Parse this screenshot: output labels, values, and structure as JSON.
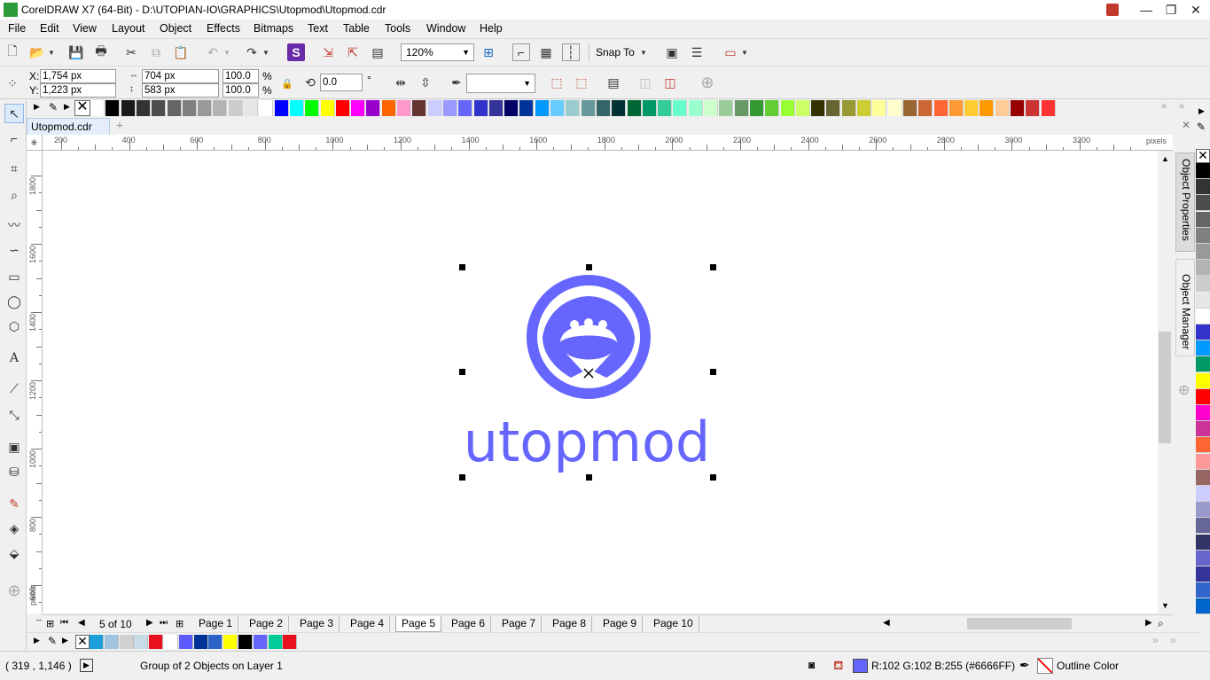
{
  "window": {
    "title": "CorelDRAW X7 (64-Bit) - D:\\UTOPIAN-IO\\GRAPHICS\\Utopmod\\Utopmod.cdr"
  },
  "menu": [
    "File",
    "Edit",
    "View",
    "Layout",
    "Object",
    "Effects",
    "Bitmaps",
    "Text",
    "Table",
    "Tools",
    "Window",
    "Help"
  ],
  "standard_toolbar": {
    "zoom": "120%",
    "snap_to": "Snap To"
  },
  "property_bar": {
    "x_label": "X:",
    "x_value": "1,754 px",
    "y_label": "Y:",
    "y_value": "1,223 px",
    "width_value": "704 px",
    "height_value": "583 px",
    "scale_w": "100.0",
    "scale_h": "100.0",
    "percent": "%",
    "rotation": "0.0",
    "degree": "°"
  },
  "document_tab": "Utopmod.cdr",
  "ruler": {
    "h_labels": [
      "200",
      "400",
      "600",
      "800",
      "1000",
      "1200",
      "1400",
      "1600",
      "1800",
      "2000",
      "2200",
      "2400",
      "2600",
      "2800",
      "3000",
      "3200"
    ],
    "h_units": "pixels",
    "v_labels": [
      "1800",
      "1600",
      "1400",
      "1200",
      "1000",
      "800",
      "600"
    ],
    "v_units": "pixels"
  },
  "logo": {
    "wordmark": "utopmod",
    "color": "#6666FF"
  },
  "dockers": [
    "Object Properties",
    "Object Manager"
  ],
  "pages": {
    "counter": "5 of 10",
    "tabs": [
      "Page 1",
      "Page 2",
      "Page 3",
      "Page 4",
      "Page 5",
      "Page 6",
      "Page 7",
      "Page 8",
      "Page 9",
      "Page 10"
    ],
    "active": "Page 5"
  },
  "status": {
    "coords": "( 319  , 1,146 )",
    "selection": "Group of 2 Objects on Layer 1",
    "fill_info": "R:102 G:102 B:255 (#6666FF)",
    "outline": "Outline Color"
  },
  "palette_top": [
    "#ffffff",
    "#000000",
    "#1a1a1a",
    "#333333",
    "#4d4d4d",
    "#666666",
    "#808080",
    "#999999",
    "#b3b3b3",
    "#cccccc",
    "#e6e6e6",
    "#ffffff",
    "#0000ff",
    "#00ffff",
    "#00ff00",
    "#ffff00",
    "#ff0000",
    "#ff00ff",
    "#9900cc",
    "#ff6600",
    "#ff99cc",
    "#663333",
    "#ccccff",
    "#9999ff",
    "#6666ff",
    "#3333cc",
    "#333399",
    "#000066",
    "#003399",
    "#0099ff",
    "#66ccff",
    "#99cccc",
    "#669999",
    "#336666",
    "#003333",
    "#006633",
    "#009966",
    "#33cc99",
    "#66ffcc",
    "#99ffcc",
    "#ccffcc",
    "#99cc99",
    "#669966",
    "#339933",
    "#66cc33",
    "#99ff33",
    "#ccff66",
    "#333300",
    "#666633",
    "#999933",
    "#cccc33",
    "#ffff99",
    "#ffffcc",
    "#996633",
    "#cc6633",
    "#ff6633",
    "#ff9933",
    "#ffcc33",
    "#ff9900",
    "#ffcc99",
    "#990000",
    "#cc3333",
    "#ff3333"
  ],
  "palette_right": [
    "#000000",
    "#333333",
    "#4d4d4d",
    "#666666",
    "#808080",
    "#999999",
    "#b3b3b3",
    "#cccccc",
    "#e6e6e6",
    "#ffffff",
    "#3333cc",
    "#0099ff",
    "#009966",
    "#ffff00",
    "#ff0000",
    "#ff00cc",
    "#cc3399",
    "#ff6633",
    "#ff9999",
    "#996666",
    "#ccccff",
    "#9999cc",
    "#666699",
    "#333366",
    "#6666cc",
    "#333399",
    "#3366cc",
    "#0066cc"
  ],
  "palette_doc": [
    "#1a9fd8",
    "#a0c4de",
    "#d0d0d0",
    "#c8dce8",
    "#e8101e",
    "#ffffff",
    "#5b5bff",
    "#003399",
    "#2b62c7",
    "#ffff00",
    "#000000",
    "#6666ff",
    "#00cc99",
    "#e8101e"
  ]
}
